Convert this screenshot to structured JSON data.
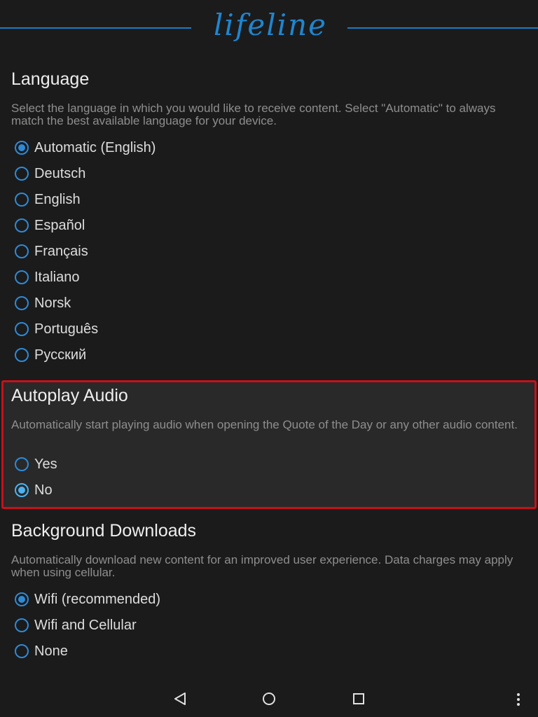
{
  "header": {
    "logo_text": "lifeline"
  },
  "language": {
    "title": "Language",
    "description": "Select the language in which you would like to receive content. Select \"Automatic\" to always match the best available language for your device.",
    "options": [
      {
        "label": "Automatic (English)",
        "selected": true
      },
      {
        "label": "Deutsch",
        "selected": false
      },
      {
        "label": "English",
        "selected": false
      },
      {
        "label": "Español",
        "selected": false
      },
      {
        "label": "Français",
        "selected": false
      },
      {
        "label": "Italiano",
        "selected": false
      },
      {
        "label": "Norsk",
        "selected": false
      },
      {
        "label": "Português",
        "selected": false
      },
      {
        "label": "Русский",
        "selected": false
      }
    ]
  },
  "autoplay": {
    "title": "Autoplay Audio",
    "description": "Automatically start playing audio when opening the Quote of the Day or any other audio content.",
    "options": [
      {
        "label": "Yes",
        "selected": false
      },
      {
        "label": "No",
        "selected": true
      }
    ],
    "highlight_color": "#c8101a"
  },
  "downloads": {
    "title": "Background Downloads",
    "description": "Automatically download new content for an improved user experience. Data charges may apply when using cellular.",
    "options": [
      {
        "label": "Wifi (recommended)",
        "selected": true
      },
      {
        "label": "Wifi and Cellular",
        "selected": false
      },
      {
        "label": "None",
        "selected": false
      }
    ]
  },
  "navbar": {
    "icons": [
      "back-icon",
      "home-icon",
      "recents-icon",
      "overflow-menu-icon"
    ]
  },
  "colors": {
    "background": "#1b1b1c",
    "accent": "#2e8ad6",
    "logo": "#1f86cf"
  }
}
